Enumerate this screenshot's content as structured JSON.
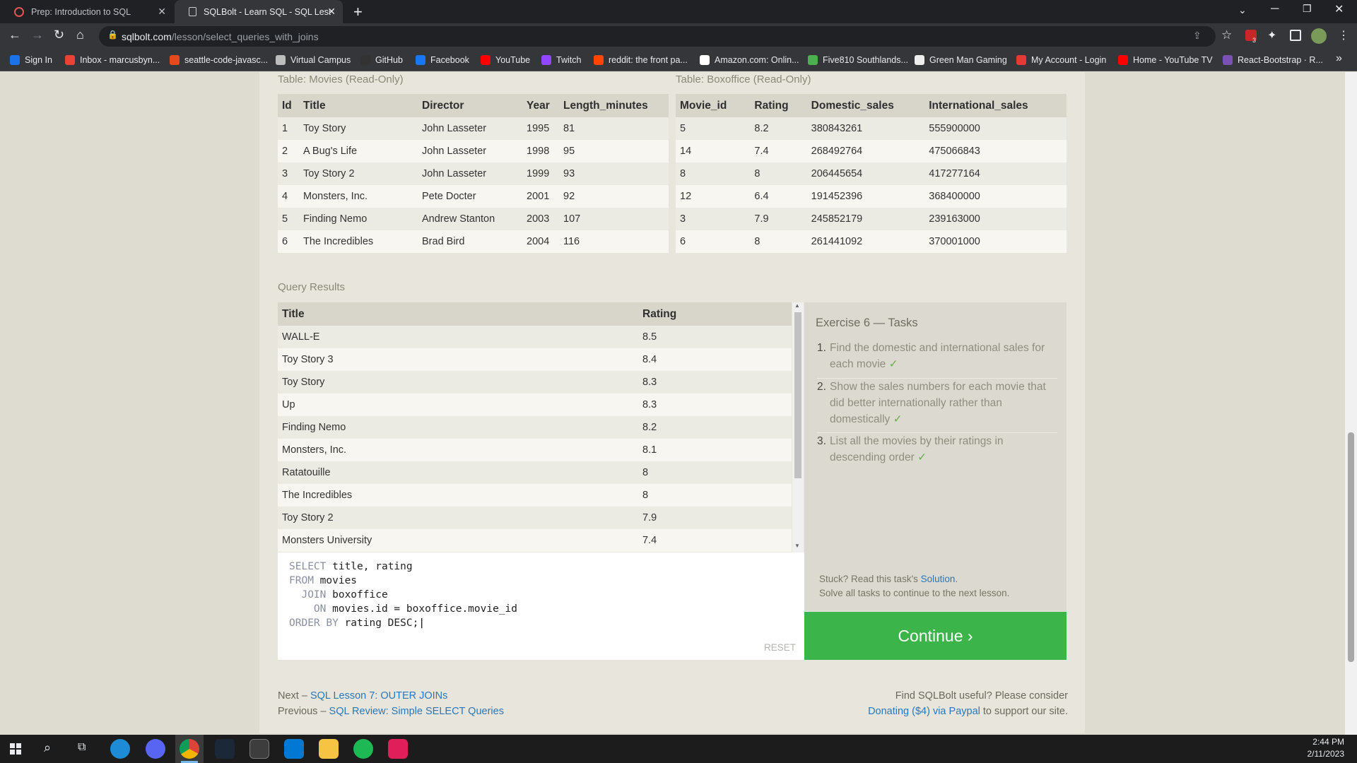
{
  "browser": {
    "tabs": [
      {
        "title": "Prep: Introduction to SQL",
        "active": false
      },
      {
        "title": "SQLBolt - Learn SQL - SQL Lesso",
        "active": true
      }
    ],
    "url_domain": "sqlbolt.com",
    "url_path": "/lesson/select_queries_with_joins",
    "bookmarks": [
      "Sign In",
      "Inbox - marcusbyn...",
      "seattle-code-javasc...",
      "Virtual Campus",
      "GitHub",
      "Facebook",
      "YouTube",
      "Twitch",
      "reddit: the front pa...",
      "Amazon.com: Onlin...",
      "Five810 Southlands...",
      "Green Man Gaming",
      "My Account - Login",
      "Home - YouTube TV",
      "React-Bootstrap · R..."
    ],
    "extension_badge": "3"
  },
  "movies_table": {
    "caption": "Table: Movies (Read-Only)",
    "headers": [
      "Id",
      "Title",
      "Director",
      "Year",
      "Length_minutes"
    ],
    "rows": [
      [
        "1",
        "Toy Story",
        "John Lasseter",
        "1995",
        "81"
      ],
      [
        "2",
        "A Bug's Life",
        "John Lasseter",
        "1998",
        "95"
      ],
      [
        "3",
        "Toy Story 2",
        "John Lasseter",
        "1999",
        "93"
      ],
      [
        "4",
        "Monsters, Inc.",
        "Pete Docter",
        "2001",
        "92"
      ],
      [
        "5",
        "Finding Nemo",
        "Andrew Stanton",
        "2003",
        "107"
      ],
      [
        "6",
        "The Incredibles",
        "Brad Bird",
        "2004",
        "116"
      ]
    ]
  },
  "boxoffice_table": {
    "caption": "Table: Boxoffice (Read-Only)",
    "headers": [
      "Movie_id",
      "Rating",
      "Domestic_sales",
      "International_sales"
    ],
    "rows": [
      [
        "5",
        "8.2",
        "380843261",
        "555900000"
      ],
      [
        "14",
        "7.4",
        "268492764",
        "475066843"
      ],
      [
        "8",
        "8",
        "206445654",
        "417277164"
      ],
      [
        "12",
        "6.4",
        "191452396",
        "368400000"
      ],
      [
        "3",
        "7.9",
        "245852179",
        "239163000"
      ],
      [
        "6",
        "8",
        "261441092",
        "370001000"
      ]
    ]
  },
  "results": {
    "caption": "Query Results",
    "headers": [
      "Title",
      "Rating"
    ],
    "rows": [
      [
        "WALL-E",
        "8.5"
      ],
      [
        "Toy Story 3",
        "8.4"
      ],
      [
        "Toy Story",
        "8.3"
      ],
      [
        "Up",
        "8.3"
      ],
      [
        "Finding Nemo",
        "8.2"
      ],
      [
        "Monsters, Inc.",
        "8.1"
      ],
      [
        "Ratatouille",
        "8"
      ],
      [
        "The Incredibles",
        "8"
      ],
      [
        "Toy Story 2",
        "7.9"
      ],
      [
        "Monsters University",
        "7.4"
      ]
    ]
  },
  "editor": {
    "lines": [
      {
        "kw": "SELECT",
        "rest": " title, rating"
      },
      {
        "kw": "FROM",
        "rest": " movies"
      },
      {
        "kw": "  JOIN",
        "rest": " boxoffice"
      },
      {
        "kw": "    ON",
        "rest": " movies.id = boxoffice.movie_id"
      },
      {
        "kw": "ORDER BY",
        "rest": " rating DESC;"
      }
    ],
    "reset_label": "RESET"
  },
  "tasks": {
    "title": "Exercise 6 — Tasks",
    "items": [
      {
        "num": "1.",
        "text": "Find the domestic and international sales for each movie",
        "done": "✓"
      },
      {
        "num": "2.",
        "text": "Show the sales numbers for each movie that did better internationally rather than domestically",
        "done": "✓"
      },
      {
        "num": "3.",
        "text": "List all the movies by their ratings in descending order",
        "done": "✓"
      }
    ],
    "stuck_prefix": "Stuck? Read this task's ",
    "stuck_link": "Solution",
    "stuck_suffix": ".",
    "solve_note": "Solve all tasks to continue to the next lesson.",
    "continue_label": "Continue ›"
  },
  "footer": {
    "next_prefix": "Next – ",
    "next_link": "SQL Lesson 7: OUTER JOINs",
    "prev_prefix": "Previous – ",
    "prev_link": "SQL Review: Simple SELECT Queries",
    "useful": "Find SQLBolt useful? Please consider",
    "donate_link": "Donating ($4) via Paypal",
    "donate_suffix": " to support our site."
  },
  "taskbar": {
    "time": "2:44 PM",
    "date": "2/11/2023"
  }
}
